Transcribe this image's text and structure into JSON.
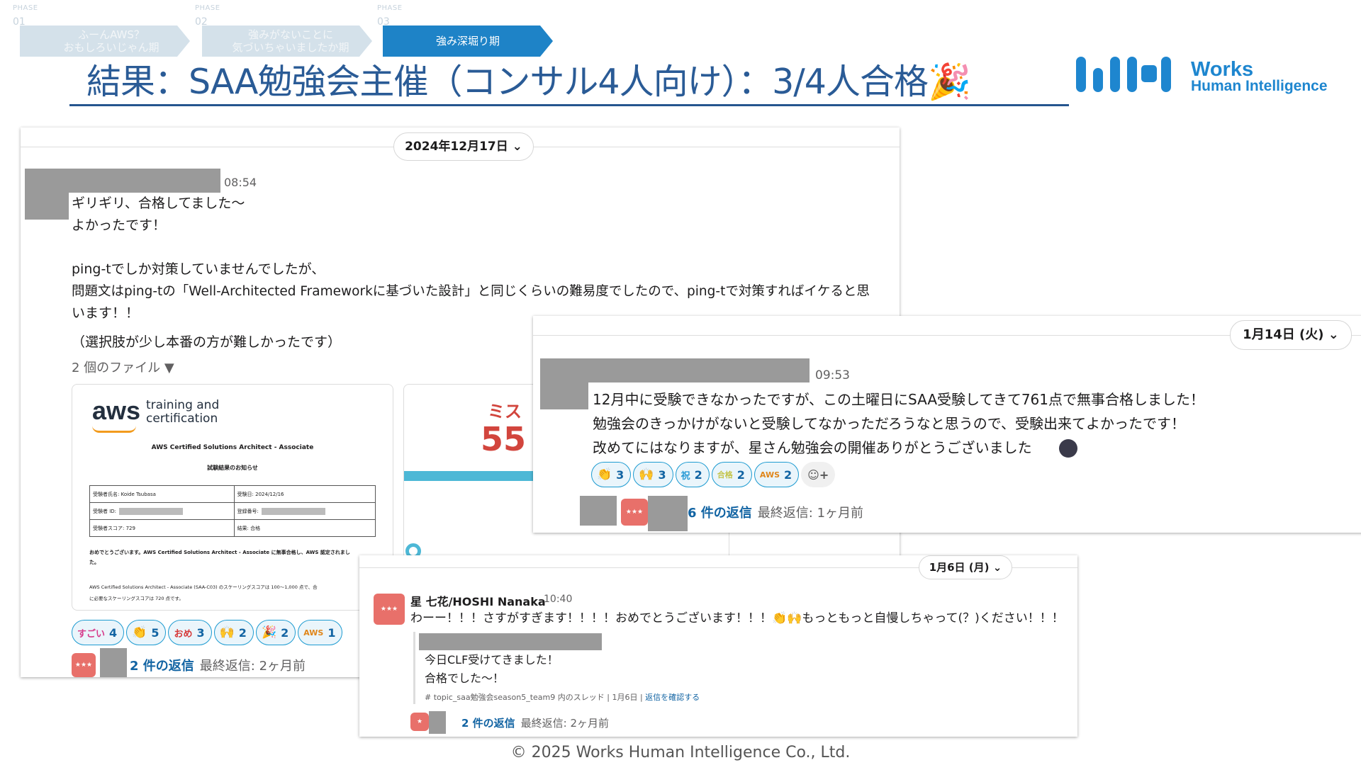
{
  "phases": [
    {
      "label": "PHASE",
      "num": "01",
      "text": "ふーんAWS？\nおもしろいじゃん期",
      "state": "inactive"
    },
    {
      "label": "PHASE",
      "num": "02",
      "text": "強みがないことに\n気づいちゃいましたか期",
      "state": "inactive"
    },
    {
      "label": "PHASE",
      "num": "03",
      "text": "強み深堀り期",
      "state": "active"
    }
  ],
  "title": "結果：SAA勉強会主催（コンサル4人向け）：3/4人合格🎉",
  "logo": {
    "line1": "Works",
    "line2": "Human Intelligence"
  },
  "card1": {
    "date": "2024年12月17日 ⌄",
    "time": "08:54",
    "lines": [
      "ギリギリ、合格してました〜",
      "よかったです！",
      "",
      "ping-tでしか対策していませんでしたが、",
      "問題文はping-tの「Well-Architected Frameworkに基づいた設計」と同じくらいの難易度でしたので、ping-tで対策すればイケると思",
      "います！！",
      "（選択肢が少し本番の方が難しかったです）"
    ],
    "files": "2 個のファイル ▼",
    "cert": {
      "brand": "aws",
      "brand_sub1": "training and",
      "brand_sub2": "certification",
      "heading": "AWS Certified Solutions Architect - Associate",
      "subheading": "試験結果のお知らせ",
      "rows": [
        [
          "受験者氏名: Koide Tsubasa",
          "受験日: 2024/12/16"
        ],
        [
          "受験者 ID:",
          "登録番号:"
        ],
        [
          "受験者スコア: 729",
          "結果: 合格"
        ]
      ],
      "note1": "おめでとうございます。AWS Certified Solutions Architect - Associate に無事合格し、AWS 認定されまし",
      "note2": "た。",
      "note3": "AWS Certified Solutions Architect - Associate (SAA-C03) のスケーリングスコアは 100〜1,000 点で、合",
      "note4": "に必要なスケーリングスコアは 720 点です。"
    },
    "second_att": {
      "label": "ミス",
      "value": "55"
    },
    "reactions": [
      {
        "emoji": "すごい",
        "count": "4"
      },
      {
        "emoji": "👏",
        "count": "5"
      },
      {
        "emoji": "おめ",
        "count": "3"
      },
      {
        "emoji": "🙌",
        "count": "2"
      },
      {
        "emoji": "🎉",
        "count": "2"
      },
      {
        "emoji": "AWS",
        "count": "1"
      }
    ],
    "replies": "2 件の返信",
    "last_reply": "最終返信: 2ヶ月前"
  },
  "card2": {
    "date": "1月14日 (火) ⌄",
    "time": "09:53",
    "lines": [
      "12月中に受験できなかったですが、この土曜日にSAA受験してきて761点で無事合格しました！",
      "勉強会のきっかけがないと受験してなかっただろうなと思うので、受験出来てよかったです！",
      "改めてにはなりますが、星さん勉強会の開催ありがとうございました"
    ],
    "reactions": [
      {
        "emoji": "👏",
        "count": "3"
      },
      {
        "emoji": "🙌",
        "count": "3"
      },
      {
        "emoji": "祝",
        "count": "2"
      },
      {
        "emoji": "合格",
        "count": "2"
      },
      {
        "emoji": "AWS",
        "count": "2"
      }
    ],
    "replies": "6 件の返信",
    "last_reply": "最終返信: 1ヶ月前"
  },
  "card3": {
    "date": "1月6日 (月) ⌄",
    "author": "星 七花/HOSHI Nanaka",
    "time": "10:40",
    "message": "わーー！！！さすがすぎます！！！！おめでとうございます！！！👏🙌もっともっと自慢しちゃって(？)ください！！！",
    "quote1": "今日CLF受けてきました！",
    "quote2": "合格でした〜！",
    "thread_meta": "# topic_saa勉強会season5_team9 内のスレッド",
    "thread_date": "1月6日",
    "thread_link": "返信を確認する",
    "replies": "2 件の返信",
    "last_reply": "最終返信: 2ヶ月前"
  },
  "footer": "© 2025 Works Human Intelligence Co., Ltd."
}
